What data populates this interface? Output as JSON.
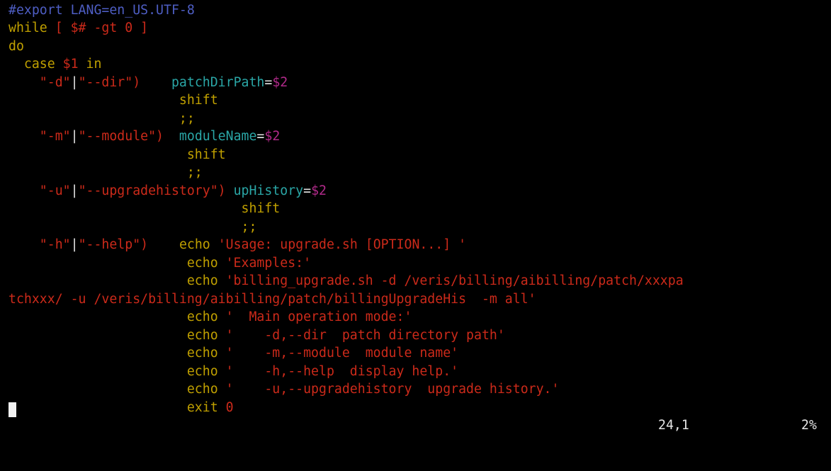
{
  "colors": {
    "background": "#000000",
    "comment": "#4e5ec4",
    "keyword": "#c0a000",
    "string": "#cc2a1a",
    "variable": "#2aa6a6",
    "special": "#b12a8a",
    "normal": "#e6e6e6"
  },
  "editor": {
    "lines": [
      {
        "segs": [
          {
            "t": "#export LANG=en_US.UTF-8",
            "c": "comment"
          }
        ]
      },
      {
        "segs": [
          {
            "t": "while",
            "c": "kw"
          },
          {
            "t": " [ ",
            "c": "red"
          },
          {
            "t": "$#",
            "c": "red"
          },
          {
            "t": " -gt ",
            "c": "red"
          },
          {
            "t": "0",
            "c": "red"
          },
          {
            "t": " ]",
            "c": "red"
          }
        ]
      },
      {
        "segs": [
          {
            "t": "do",
            "c": "kw"
          }
        ]
      },
      {
        "segs": [
          {
            "t": "  case ",
            "c": "kw"
          },
          {
            "t": "$1",
            "c": "red"
          },
          {
            "t": " in",
            "c": "kw"
          }
        ]
      },
      {
        "segs": [
          {
            "t": "    \"-d\"",
            "c": "red"
          },
          {
            "t": "|",
            "c": "white"
          },
          {
            "t": "\"--dir\")",
            "c": "red"
          },
          {
            "t": "    ",
            "c": "white"
          },
          {
            "t": "patchDirPath",
            "c": "teal"
          },
          {
            "t": "=",
            "c": "white"
          },
          {
            "t": "$2",
            "c": "purple"
          }
        ]
      },
      {
        "segs": [
          {
            "t": "                      shift",
            "c": "kw"
          }
        ]
      },
      {
        "segs": [
          {
            "t": "                      ;;",
            "c": "kw"
          }
        ]
      },
      {
        "segs": [
          {
            "t": "    \"-m\"",
            "c": "red"
          },
          {
            "t": "|",
            "c": "white"
          },
          {
            "t": "\"--module\")",
            "c": "red"
          },
          {
            "t": "  ",
            "c": "white"
          },
          {
            "t": "moduleName",
            "c": "teal"
          },
          {
            "t": "=",
            "c": "white"
          },
          {
            "t": "$2",
            "c": "purple"
          }
        ]
      },
      {
        "segs": [
          {
            "t": "                       shift",
            "c": "kw"
          }
        ]
      },
      {
        "segs": [
          {
            "t": "                       ;;",
            "c": "kw"
          }
        ]
      },
      {
        "segs": [
          {
            "t": "    \"-u\"",
            "c": "red"
          },
          {
            "t": "|",
            "c": "white"
          },
          {
            "t": "\"--upgradehistory\")",
            "c": "red"
          },
          {
            "t": " ",
            "c": "white"
          },
          {
            "t": "upHistory",
            "c": "teal"
          },
          {
            "t": "=",
            "c": "white"
          },
          {
            "t": "$2",
            "c": "purple"
          }
        ]
      },
      {
        "segs": [
          {
            "t": "                              shift",
            "c": "kw"
          }
        ]
      },
      {
        "segs": [
          {
            "t": "                              ;;",
            "c": "kw"
          }
        ]
      },
      {
        "segs": [
          {
            "t": "    \"-h\"",
            "c": "red"
          },
          {
            "t": "|",
            "c": "white"
          },
          {
            "t": "\"--help\")",
            "c": "red"
          },
          {
            "t": "    ",
            "c": "white"
          },
          {
            "t": "echo",
            "c": "kw"
          },
          {
            "t": " 'Usage: upgrade.sh [OPTION...] '",
            "c": "red"
          }
        ]
      },
      {
        "segs": [
          {
            "t": "                       echo",
            "c": "kw"
          },
          {
            "t": " 'Examples:'",
            "c": "red"
          }
        ]
      },
      {
        "segs": [
          {
            "t": "                       echo",
            "c": "kw"
          },
          {
            "t": " 'billing_upgrade.sh -d /veris/billing/aibilling/patch/xxxpa",
            "c": "red"
          }
        ]
      },
      {
        "segs": [
          {
            "t": "tchxxx/ -u /veris/billing/aibilling/patch/billingUpgradeHis  -m all'",
            "c": "red"
          }
        ]
      },
      {
        "segs": [
          {
            "t": "                       echo",
            "c": "kw"
          },
          {
            "t": " '  Main operation mode:'",
            "c": "red"
          }
        ]
      },
      {
        "segs": [
          {
            "t": "                       echo",
            "c": "kw"
          },
          {
            "t": " '    -d,--dir  patch directory path'",
            "c": "red"
          }
        ]
      },
      {
        "segs": [
          {
            "t": "                       echo",
            "c": "kw"
          },
          {
            "t": " '    -m,--module  module name'",
            "c": "red"
          }
        ]
      },
      {
        "segs": [
          {
            "t": "                       echo",
            "c": "kw"
          },
          {
            "t": " '    -h,--help  display help.'",
            "c": "red"
          }
        ]
      },
      {
        "segs": [
          {
            "t": "                       echo",
            "c": "kw"
          },
          {
            "t": " '    -u,--upgradehistory  upgrade history.'",
            "c": "red"
          }
        ]
      },
      {
        "segs": [
          {
            "t": "                       exit ",
            "c": "kw"
          },
          {
            "t": "0",
            "c": "red"
          }
        ]
      }
    ]
  },
  "status": {
    "position": "24,1",
    "percent": "2%"
  }
}
